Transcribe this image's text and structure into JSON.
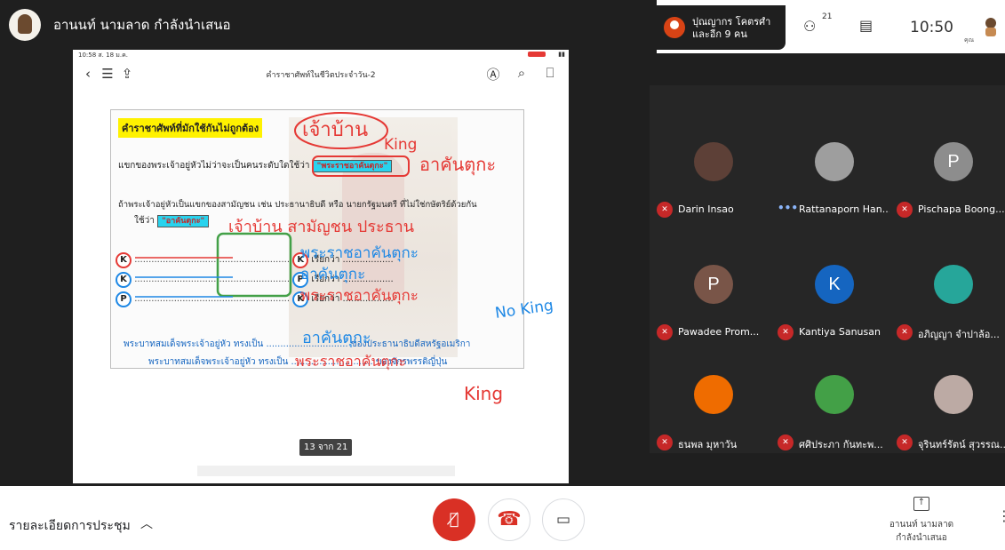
{
  "presenter": {
    "name": "อานนท์ นามลาด กำลังนำเสนอ"
  },
  "slide": {
    "status_time": "10:58 ส. 18 ม.ค.",
    "doc_title": "คำราชาศัพท์ในชีวิตประจำวัน-2",
    "heading": "คำราชาศัพท์ที่มักใช้กันไม่ถูกต้อง",
    "line1": "แขกของพระเจ้าอยู่หัวไม่ว่าจะเป็นคนระดับใดใช้ว่า",
    "box1": "\"พระราชอาคันตุกะ\"",
    "line2": "ถ้าพระเจ้าอยู่หัวเป็นแขกของสามัญชน เช่น ประธานาธิบดี หรือ นายกรัฐมนตรี ที่ไม่ใช่กษัตริย์ด้วยกัน",
    "line3": "ใช้ว่า",
    "box2": "\"อาคันตุกะ\"",
    "left_circles": [
      "K",
      "K",
      "P"
    ],
    "right_circles": [
      "K",
      "P",
      "K"
    ],
    "call_label": "เรียกว่า",
    "bottom1": "พระบาทสมเด็จพระเจ้าอยู่หัว ทรงเป็น ............................. ของประธานาธิบดีสหรัฐอเมริกา",
    "bottom2": "พระบาทสมเด็จพระเจ้าอยู่หัว ทรงเป็น ............................. ของจักรพรรดิญี่ปุ่น",
    "page": "13 จาก 21"
  },
  "ink": {
    "w1": "เจ้าบ้าน",
    "w2": "King",
    "w3": "อาคันตุกะ",
    "w4": "เจ้าบ้าน สามัญชน ประธาน",
    "w5": "พระราชอาคันตุกะ",
    "w6": "อาคันตุกะ",
    "w7": "พระราชอาคันตุกะ",
    "w8": "No King",
    "w9": "อาคันตุกะ",
    "w10": "พระราชอาคันตุกะ",
    "w11": "King"
  },
  "topbar": {
    "notif_name": "ปุณญากร โคตรศำ และอีก 9 คน",
    "people_count": "21",
    "clock": "10:50",
    "you": "คุณ"
  },
  "participants": [
    {
      "name": "Darin Insao",
      "state": "muted",
      "initial": "",
      "color": "#5d4037"
    },
    {
      "name": "Rattanaporn Han...",
      "state": "speaking",
      "initial": "",
      "color": "#9e9e9e"
    },
    {
      "name": "Pischapa Boong...",
      "state": "muted",
      "initial": "P",
      "color": "#8d8d8d"
    },
    {
      "name": "Pawadee Prom...",
      "state": "muted",
      "initial": "P",
      "color": "#795548"
    },
    {
      "name": "Kantiya Sanusan",
      "state": "muted",
      "initial": "K",
      "color": "#1565c0"
    },
    {
      "name": "อภิญญา จำปาล้อ...",
      "state": "muted",
      "initial": "",
      "color": "#26a69a"
    },
    {
      "name": "ธนพล มุหาวัน",
      "state": "muted",
      "initial": "",
      "color": "#ef6c00"
    },
    {
      "name": "ศศิประภา กันทะพ...",
      "state": "muted",
      "initial": "",
      "color": "#43a047"
    },
    {
      "name": "จุรินทร์รัตน์ สุวรรณ...",
      "state": "muted",
      "initial": "",
      "color": "#bcaaa4"
    }
  ],
  "bottom": {
    "details": "รายละเอียดการประชุม",
    "present_line1": "อานนท์ นามลาด",
    "present_line2": "กำลังนำเสนอ"
  }
}
